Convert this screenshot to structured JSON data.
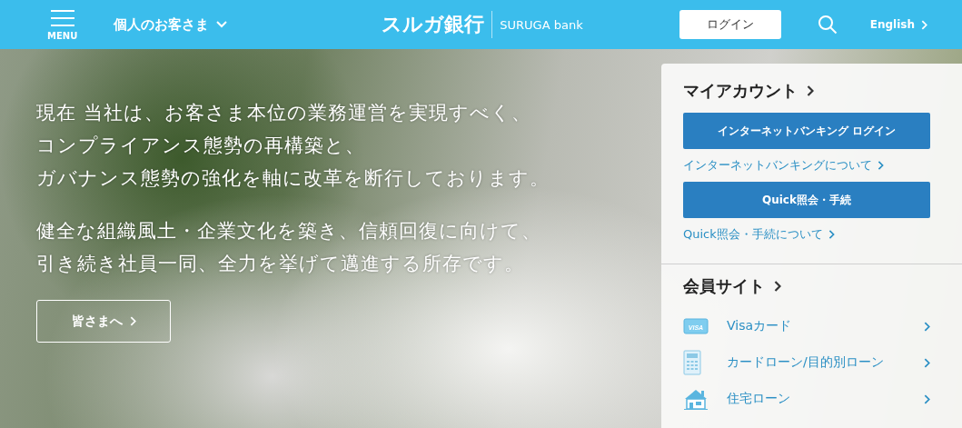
{
  "header": {
    "menu_label": "MENU",
    "segment": "個人のお客さま",
    "logo_jp": "スルガ銀行",
    "logo_en": "SURUGA bank",
    "login": "ログイン",
    "language": "English"
  },
  "hero": {
    "paragraphs": [
      [
        "現在 当社は、お客さま本位の業務運営を実現すべく、",
        "コンプライアンス態勢の再構築と、",
        "ガバナンス態勢の強化を軸に改革を断行しております。"
      ],
      [
        "健全な組織風土・企業文化を築き、信頼回復に向けて、",
        "引き続き社員一同、全力を挙げて邁進する所存です。"
      ]
    ],
    "button": "皆さまへ"
  },
  "panel": {
    "my_account": {
      "title": "マイアカウント",
      "buttons": [
        "インターネットバンキング ログイン",
        "Quick照会・手続"
      ],
      "links": [
        "インターネットバンキングについて",
        "Quick照会・手続について"
      ]
    },
    "member_site": {
      "title": "会員サイト",
      "items": [
        {
          "kind": "visa",
          "icon_label": "VISA",
          "label": "Visaカード"
        },
        {
          "kind": "calculator",
          "label": "カードローン/目的別ローン"
        },
        {
          "kind": "house",
          "label": "住宅ローン"
        }
      ]
    }
  }
}
